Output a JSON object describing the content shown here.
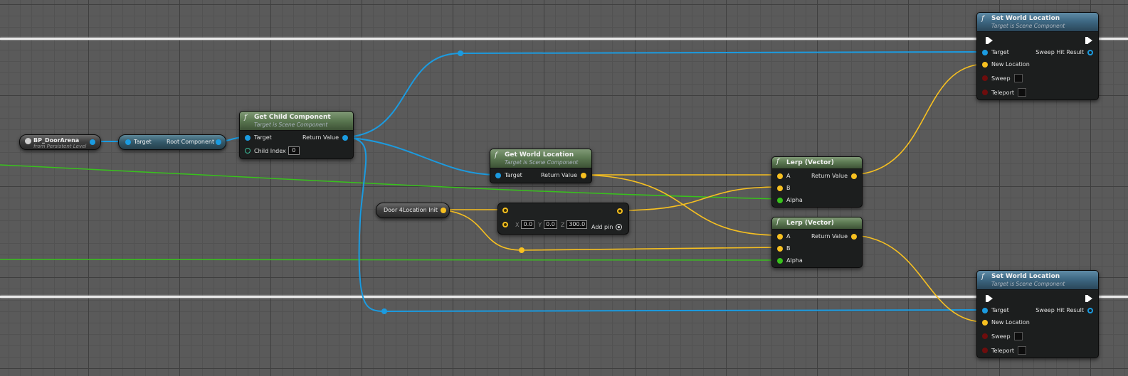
{
  "nodes": {
    "bp_door_arena": {
      "title": "BP_DoorArena",
      "subtitle": "from Persistent Level"
    },
    "root_component": {
      "target": "Target",
      "output": "Root Component"
    },
    "get_child_component": {
      "title": "Get Child Component",
      "subtitle": "Target is Scene Component",
      "target": "Target",
      "return_value": "Return Value",
      "child_index_label": "Child Index",
      "child_index_value": "0"
    },
    "get_world_location": {
      "title": "Get World Location",
      "subtitle": "Target is Scene Component",
      "target": "Target",
      "return_value": "Return Value"
    },
    "door_location_var": {
      "label": "Door 4Location Init"
    },
    "vector_add": {
      "x_label": "X",
      "x_value": "0.0",
      "y_label": "Y",
      "y_value": "0.0",
      "z_label": "Z",
      "z_value": "300.0",
      "add_pin_label": "Add pin"
    },
    "lerp_1": {
      "title": "Lerp (Vector)",
      "a": "A",
      "b": "B",
      "alpha": "Alpha",
      "return_value": "Return Value"
    },
    "lerp_2": {
      "title": "Lerp (Vector)",
      "a": "A",
      "b": "B",
      "alpha": "Alpha",
      "return_value": "Return Value"
    },
    "set_world_location_1": {
      "title": "Set World Location",
      "subtitle": "Target is Scene Component",
      "target": "Target",
      "sweep_hit_result": "Sweep Hit Result",
      "new_location": "New Location",
      "sweep": "Sweep",
      "teleport": "Teleport"
    },
    "set_world_location_2": {
      "title": "Set World Location",
      "subtitle": "Target is Scene Component",
      "target": "Target",
      "sweep_hit_result": "Sweep Hit Result",
      "new_location": "New Location",
      "sweep": "Sweep",
      "teleport": "Teleport"
    }
  },
  "colors": {
    "object_wire": "#1b9be0",
    "vector_wire": "#f7c020",
    "float_wire": "#38c21c",
    "exec_line": "#e8e8e8",
    "function_header_blue": "#3e6883",
    "function_header_green": "#5d7a53"
  }
}
